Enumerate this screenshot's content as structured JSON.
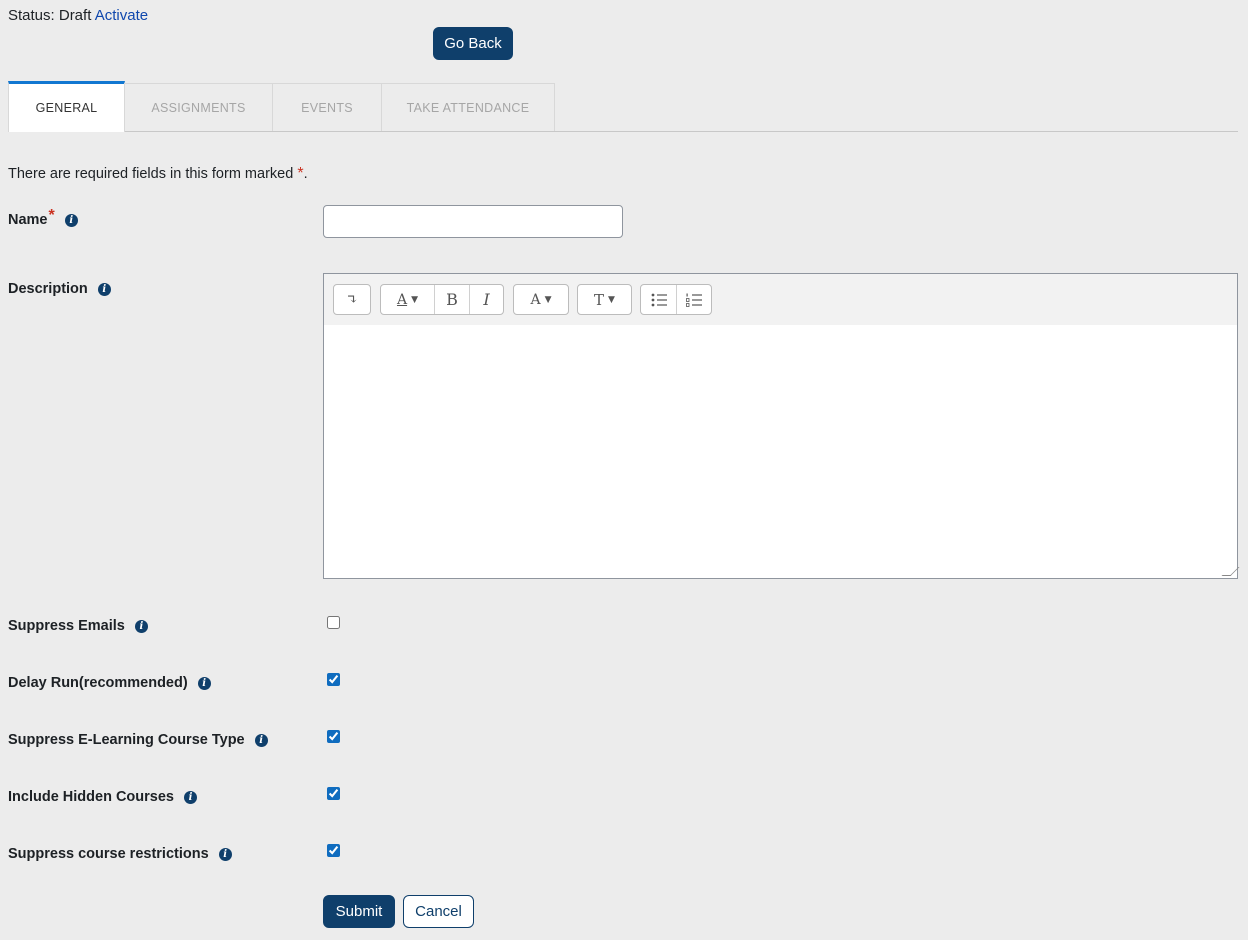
{
  "status": {
    "prefix": "Status: Draft",
    "link": "Activate"
  },
  "go_back_label": "Go Back",
  "tabs": [
    {
      "label": "GENERAL",
      "active": true
    },
    {
      "label": "ASSIGNMENTS",
      "active": false
    },
    {
      "label": "EVENTS",
      "active": false
    },
    {
      "label": "TAKE ATTENDANCE",
      "active": false
    }
  ],
  "required_note": {
    "text": "There are required fields in this form marked",
    "marker": "*",
    "end": "."
  },
  "fields": {
    "name": {
      "label": "Name",
      "required_marker": "*",
      "value": ""
    },
    "description": {
      "label": "Description",
      "value": ""
    },
    "suppress_emails": {
      "label": "Suppress Emails",
      "checked": false
    },
    "delay_run": {
      "label": "Delay Run(recommended)",
      "checked": true
    },
    "suppress_elearning": {
      "label": "Suppress E-Learning Course Type",
      "checked": true
    },
    "include_hidden": {
      "label": "Include Hidden Courses",
      "checked": true
    },
    "suppress_restrictions": {
      "label": "Suppress course restrictions",
      "checked": true
    }
  },
  "info_glyph": "i",
  "toolbar": {
    "toggle_glyph": "↴",
    "style_glyph": "A",
    "bold_glyph": "B",
    "italic_glyph": "I",
    "color_glyph": "A",
    "size_glyph": "T",
    "caret": "▼"
  },
  "buttons": {
    "submit": "Submit",
    "cancel": "Cancel"
  },
  "colors": {
    "primary": "#0f3f6b",
    "link": "#0f47ad",
    "required": "#ca3120",
    "tab_accent": "#1177d1"
  }
}
